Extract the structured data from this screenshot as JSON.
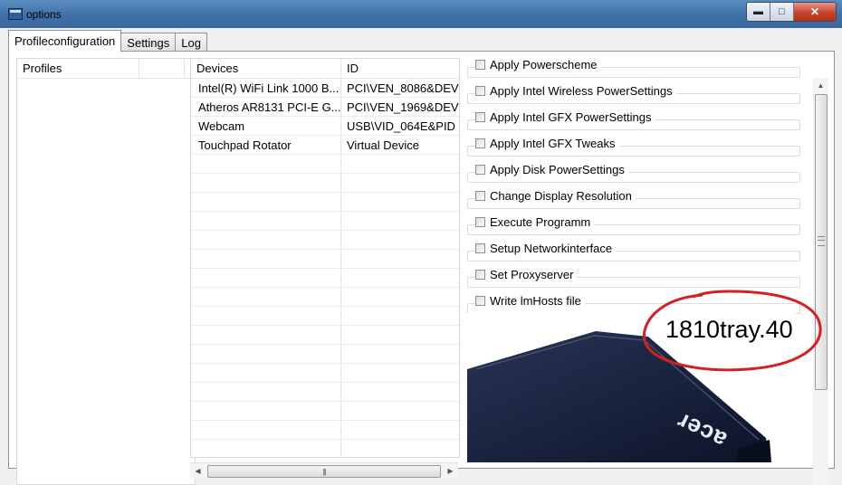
{
  "window": {
    "title": "options",
    "controls": [
      "minimize",
      "maximize",
      "close"
    ]
  },
  "tabs": [
    {
      "label": "Profileconfiguration",
      "active": true
    },
    {
      "label": "Settings",
      "active": false
    },
    {
      "label": "Log",
      "active": false
    }
  ],
  "profiles": {
    "columns": [
      "Profiles",
      ""
    ],
    "items": []
  },
  "devices": {
    "columns": [
      "Devices",
      "ID"
    ],
    "rows": [
      {
        "device": "Intel(R) WiFi Link 1000 B...",
        "id": "PCI\\VEN_8086&DEV"
      },
      {
        "device": "Atheros AR8131 PCI-E G...",
        "id": "PCI\\VEN_1969&DEV"
      },
      {
        "device": "Webcam",
        "id": "USB\\VID_064E&PID"
      },
      {
        "device": "Touchpad Rotator",
        "id": "Virtual Device"
      }
    ]
  },
  "options": [
    {
      "label": "Apply Powerscheme",
      "checked": false
    },
    {
      "label": "Apply Intel Wireless PowerSettings",
      "checked": false
    },
    {
      "label": "Apply Intel GFX PowerSettings",
      "checked": false
    },
    {
      "label": "Apply Intel GFX Tweaks",
      "checked": false
    },
    {
      "label": "Apply Disk PowerSettings",
      "checked": false
    },
    {
      "label": "Change Display Resolution",
      "checked": false
    },
    {
      "label": "Execute Programm",
      "checked": false
    },
    {
      "label": "Setup Networkinterface",
      "checked": false
    },
    {
      "label": "Set Proxyserver",
      "checked": false
    },
    {
      "label": "Write lmHosts file",
      "checked": false
    }
  ],
  "banner": {
    "version_text": "1810tray.40",
    "logo_text": "acer",
    "highlight_color": "#d42020",
    "laptop_color": "#1c2640"
  }
}
